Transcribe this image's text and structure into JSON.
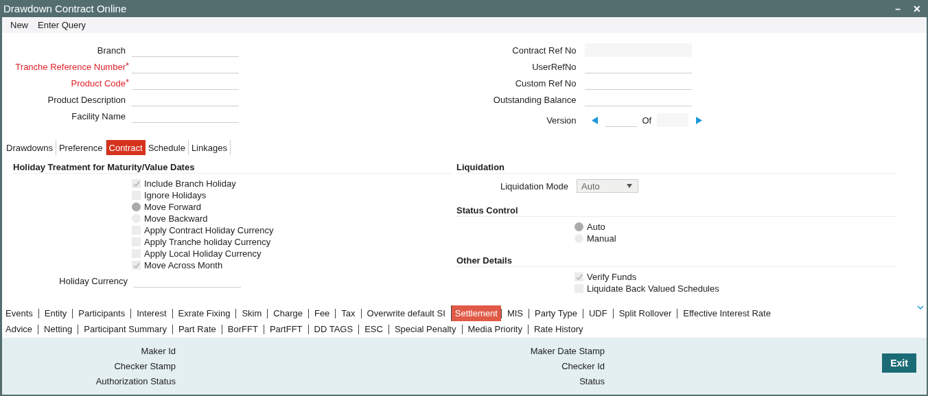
{
  "window": {
    "title": "Drawdown Contract Online",
    "controls": [
      "–",
      "✕"
    ]
  },
  "menu": [
    "New",
    "Enter Query"
  ],
  "required_mark": "*",
  "header_left": [
    {
      "label": "Branch",
      "required": false
    },
    {
      "label": "Tranche Reference Number",
      "required": true
    },
    {
      "label": "Product Code",
      "required": true
    },
    {
      "label": "Product Description",
      "required": false
    },
    {
      "label": "Facility Name",
      "required": false
    }
  ],
  "header_right": [
    {
      "label": "Contract Ref No",
      "disabled": true
    },
    {
      "label": "UserRefNo",
      "disabled": false
    },
    {
      "label": "Custom Ref No",
      "disabled": false
    },
    {
      "label": "Outstanding Balance",
      "disabled": false
    }
  ],
  "version": {
    "label": "Version",
    "of": "Of"
  },
  "tabs": [
    {
      "label": "Drawdowns",
      "selected": false
    },
    {
      "label": "Preference",
      "selected": false
    },
    {
      "label": "Contract",
      "selected": true
    },
    {
      "label": "Schedule",
      "selected": false
    },
    {
      "label": "Linkages",
      "selected": false
    }
  ],
  "holiday": {
    "title": "Holiday Treatment for Maturity/Value Dates",
    "options": [
      {
        "kind": "checkbox",
        "label": "Include Branch Holiday",
        "checked": true
      },
      {
        "kind": "checkbox",
        "label": "Ignore Holidays",
        "checked": false
      },
      {
        "kind": "radio",
        "label": "Move Forward",
        "checked": true
      },
      {
        "kind": "radio",
        "label": "Move Backward",
        "checked": false
      },
      {
        "kind": "checkbox",
        "label": "Apply Contract Holiday Currency",
        "checked": false
      },
      {
        "kind": "checkbox",
        "label": "Apply Tranche holiday Currency",
        "checked": false
      },
      {
        "kind": "checkbox",
        "label": "Apply Local Holiday Currency",
        "checked": false
      },
      {
        "kind": "checkbox",
        "label": "Move Across Month",
        "checked": true
      }
    ],
    "currency_label": "Holiday Currency"
  },
  "liquidation": {
    "title": "Liquidation",
    "mode_label": "Liquidation Mode",
    "mode_value": "Auto"
  },
  "status_control": {
    "title": "Status Control",
    "options": [
      {
        "label": "Auto",
        "selected": true
      },
      {
        "label": "Manual",
        "selected": false
      }
    ]
  },
  "other_details": {
    "title": "Other Details",
    "options": [
      {
        "label": "Verify Funds",
        "checked": true
      },
      {
        "label": "Liquidate Back Valued Schedules",
        "checked": false
      }
    ]
  },
  "subscreens": [
    [
      {
        "label": "Events",
        "selected": false
      },
      {
        "label": "Entity",
        "selected": false
      },
      {
        "label": "Participants",
        "selected": false
      },
      {
        "label": "Interest",
        "selected": false
      },
      {
        "label": "Exrate Fixing",
        "selected": false
      },
      {
        "label": "Skim",
        "selected": false
      },
      {
        "label": "Charge",
        "selected": false
      },
      {
        "label": "Fee",
        "selected": false
      },
      {
        "label": "Tax",
        "selected": false
      },
      {
        "label": "Overwrite default SI",
        "selected": false
      },
      {
        "label": "Settlement",
        "selected": true
      },
      {
        "label": "MIS",
        "selected": false
      },
      {
        "label": "Party Type",
        "selected": false
      },
      {
        "label": "UDF",
        "selected": false
      },
      {
        "label": "Split Rollover",
        "selected": false
      },
      {
        "label": "Effective Interest Rate",
        "selected": false
      }
    ],
    [
      {
        "label": "Advice",
        "selected": false
      },
      {
        "label": "Netting",
        "selected": false
      },
      {
        "label": "Participant Summary",
        "selected": false
      },
      {
        "label": "Part Rate",
        "selected": false
      },
      {
        "label": "BorFFT",
        "selected": false
      },
      {
        "label": "PartFFT",
        "selected": false
      },
      {
        "label": "DD TAGS",
        "selected": false
      },
      {
        "label": "ESC",
        "selected": false
      },
      {
        "label": "Special Penalty",
        "selected": false
      },
      {
        "label": "Media Priority",
        "selected": false
      },
      {
        "label": "Rate History",
        "selected": false
      }
    ]
  ],
  "audit_left": [
    "Maker Id",
    "Checker Stamp",
    "Authorization Status"
  ],
  "audit_right": [
    "Maker Date Stamp",
    "Checker Id",
    "Status"
  ],
  "exit_button": "Exit"
}
